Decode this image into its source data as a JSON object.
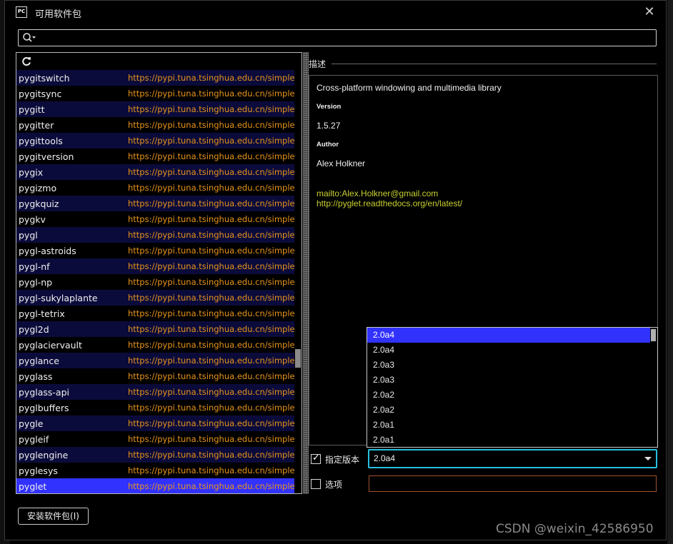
{
  "window": {
    "icon_text": "PC",
    "title": "可用软件包",
    "close_glyph": "✕"
  },
  "search": {
    "placeholder": "",
    "value": ""
  },
  "packages": [
    {
      "name": "pygitswitch",
      "url": "https://pypi.tuna.tsinghua.edu.cn/simple/"
    },
    {
      "name": "pygitsync",
      "url": "https://pypi.tuna.tsinghua.edu.cn/simple/"
    },
    {
      "name": "pygitt",
      "url": "https://pypi.tuna.tsinghua.edu.cn/simple/"
    },
    {
      "name": "pygitter",
      "url": "https://pypi.tuna.tsinghua.edu.cn/simple/"
    },
    {
      "name": "pygittools",
      "url": "https://pypi.tuna.tsinghua.edu.cn/simple/"
    },
    {
      "name": "pygitversion",
      "url": "https://pypi.tuna.tsinghua.edu.cn/simple/"
    },
    {
      "name": "pygix",
      "url": "https://pypi.tuna.tsinghua.edu.cn/simple/"
    },
    {
      "name": "pygizmo",
      "url": "https://pypi.tuna.tsinghua.edu.cn/simple/"
    },
    {
      "name": "pygkquiz",
      "url": "https://pypi.tuna.tsinghua.edu.cn/simple/"
    },
    {
      "name": "pygkv",
      "url": "https://pypi.tuna.tsinghua.edu.cn/simple/"
    },
    {
      "name": "pygl",
      "url": "https://pypi.tuna.tsinghua.edu.cn/simple/"
    },
    {
      "name": "pygl-astroids",
      "url": "https://pypi.tuna.tsinghua.edu.cn/simple/"
    },
    {
      "name": "pygl-nf",
      "url": "https://pypi.tuna.tsinghua.edu.cn/simple/"
    },
    {
      "name": "pygl-np",
      "url": "https://pypi.tuna.tsinghua.edu.cn/simple/"
    },
    {
      "name": "pygl-sukylaplante",
      "url": "https://pypi.tuna.tsinghua.edu.cn/simple/"
    },
    {
      "name": "pygl-tetrix",
      "url": "https://pypi.tuna.tsinghua.edu.cn/simple/"
    },
    {
      "name": "pygl2d",
      "url": "https://pypi.tuna.tsinghua.edu.cn/simple/"
    },
    {
      "name": "pyglaciervault",
      "url": "https://pypi.tuna.tsinghua.edu.cn/simple/"
    },
    {
      "name": "pyglance",
      "url": "https://pypi.tuna.tsinghua.edu.cn/simple/"
    },
    {
      "name": "pyglass",
      "url": "https://pypi.tuna.tsinghua.edu.cn/simple/"
    },
    {
      "name": "pyglass-api",
      "url": "https://pypi.tuna.tsinghua.edu.cn/simple/"
    },
    {
      "name": "pyglbuffers",
      "url": "https://pypi.tuna.tsinghua.edu.cn/simple/"
    },
    {
      "name": "pygle",
      "url": "https://pypi.tuna.tsinghua.edu.cn/simple/"
    },
    {
      "name": "pygleif",
      "url": "https://pypi.tuna.tsinghua.edu.cn/simple/"
    },
    {
      "name": "pyglengine",
      "url": "https://pypi.tuna.tsinghua.edu.cn/simple/"
    },
    {
      "name": "pyglesys",
      "url": "https://pypi.tuna.tsinghua.edu.cn/simple/"
    },
    {
      "name": "pyglet",
      "url": "https://pypi.tuna.tsinghua.edu.cn/simple/",
      "selected": true
    }
  ],
  "description": {
    "section_label": "描述",
    "summary": "Cross-platform windowing and multimedia library",
    "version_label": "Version",
    "version_value": "1.5.27",
    "author_label": "Author",
    "author_value": "Alex Holkner",
    "links": [
      "mailto:Alex.Holkner@gmail.com",
      "http://pyglet.readthedocs.org/en/latest/"
    ]
  },
  "version_dropdown": {
    "items": [
      "2.0a4",
      "2.0a4",
      "2.0a3",
      "2.0a3",
      "2.0a2",
      "2.0a2",
      "2.0a1",
      "2.0a1"
    ],
    "highlighted_index": 0
  },
  "specify_version": {
    "label": "指定版本",
    "checked": true,
    "value": "2.0a4"
  },
  "options": {
    "label": "选项",
    "checked": false,
    "value": ""
  },
  "install_button": {
    "label": "安装软件包(I)"
  },
  "watermark": "CSDN @weixin_42586950",
  "colors": {
    "row_alt": "#0b0b3b",
    "selection": "#3232ff",
    "url_text": "#e8941a",
    "link_text": "#c8d030",
    "focus_border": "#27c0e0"
  }
}
